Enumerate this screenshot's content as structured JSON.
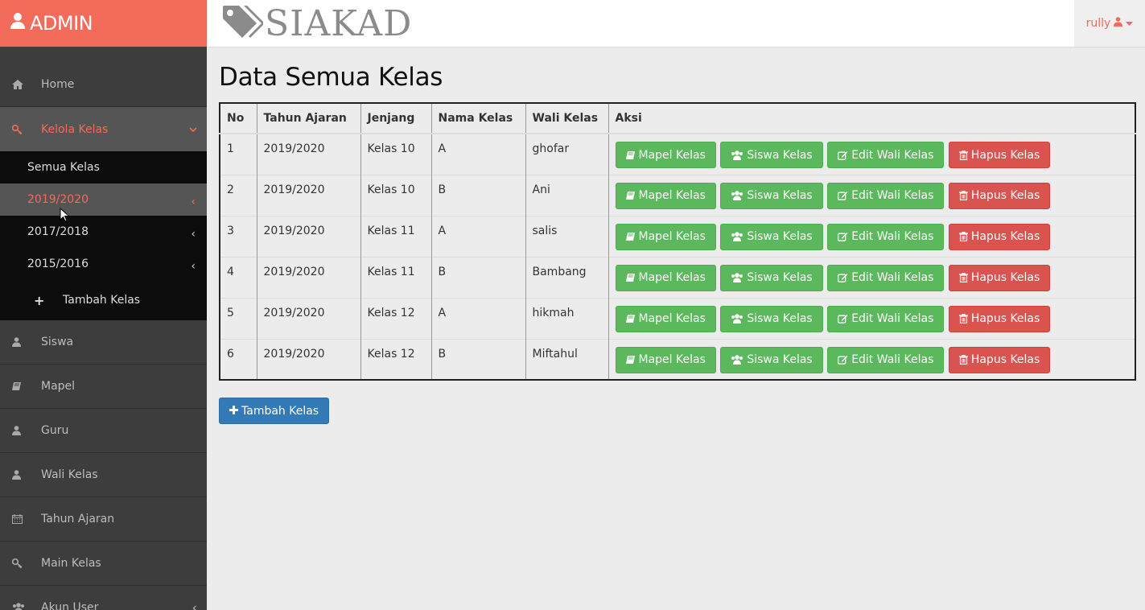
{
  "sidebar": {
    "brand": "ADMIN",
    "items": [
      {
        "label": "Home",
        "icon": "home-icon"
      },
      {
        "label": "Kelola Kelas",
        "icon": "key-icon"
      },
      {
        "label": "Siswa",
        "icon": "user-icon"
      },
      {
        "label": "Mapel",
        "icon": "book-icon"
      },
      {
        "label": "Guru",
        "icon": "user-icon"
      },
      {
        "label": "Wali Kelas",
        "icon": "user-icon"
      },
      {
        "label": "Tahun Ajaran",
        "icon": "calendar-icon"
      },
      {
        "label": "Main Kelas",
        "icon": "key-icon"
      },
      {
        "label": "Akun User",
        "icon": "users-icon"
      }
    ],
    "submenu": [
      {
        "label": "Semua Kelas"
      },
      {
        "label": "2019/2020"
      },
      {
        "label": "2017/2018"
      },
      {
        "label": "2015/2016"
      },
      {
        "label": "Tambah Kelas"
      }
    ]
  },
  "header": {
    "logo": "SIAKAD",
    "user": "rully"
  },
  "main": {
    "title": "Data Semua Kelas",
    "columns": [
      "No",
      "Tahun Ajaran",
      "Jenjang",
      "Nama Kelas",
      "Wali Kelas",
      "Aksi"
    ],
    "rows": [
      [
        "1",
        "2019/2020",
        "Kelas 10",
        "A",
        "ghofar"
      ],
      [
        "2",
        "2019/2020",
        "Kelas 10",
        "B",
        "Ani"
      ],
      [
        "3",
        "2019/2020",
        "Kelas 11",
        "A",
        "salis"
      ],
      [
        "4",
        "2019/2020",
        "Kelas 11",
        "B",
        "Bambang"
      ],
      [
        "5",
        "2019/2020",
        "Kelas 12",
        "A",
        "hikmah"
      ],
      [
        "6",
        "2019/2020",
        "Kelas 12",
        "B",
        "Miftahul"
      ]
    ],
    "actions": {
      "mapel": "Mapel Kelas",
      "siswa": "Siswa Kelas",
      "edit": "Edit Wali Kelas",
      "hapus": "Hapus Kelas"
    },
    "add_button": "Tambah Kelas"
  },
  "colors": {
    "brand": "#f26b5b",
    "sidebar": "#3d3d3d",
    "success": "#5cb85c",
    "danger": "#d9534f",
    "primary": "#337ab7"
  }
}
